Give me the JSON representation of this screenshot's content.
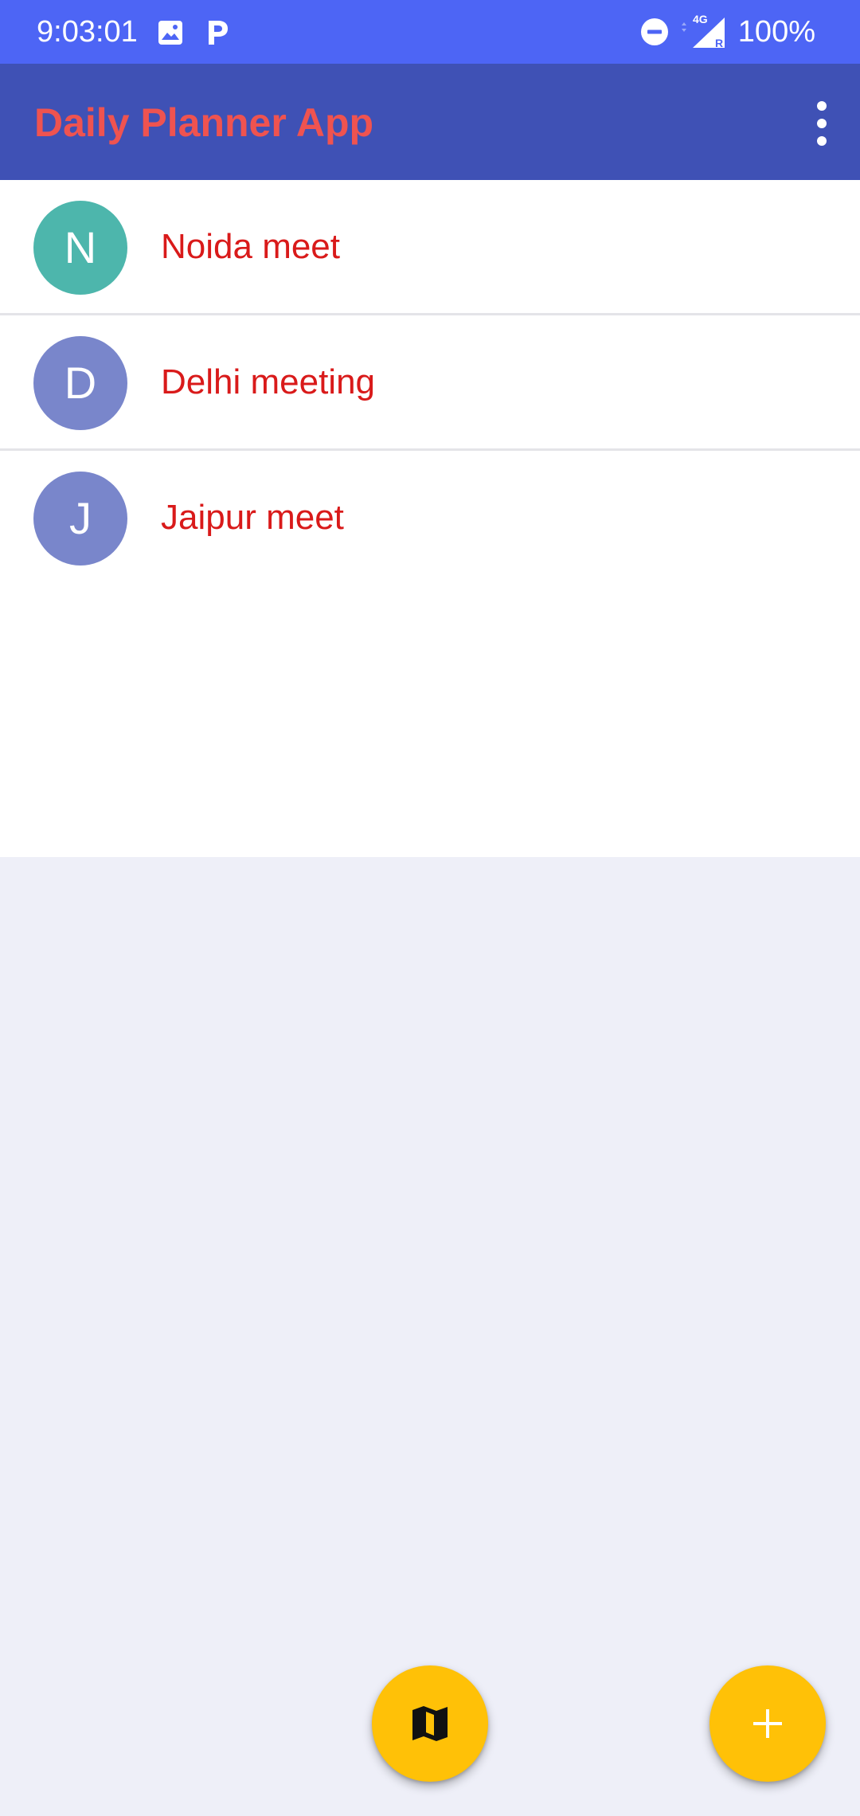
{
  "status_bar": {
    "time": "9:03:01",
    "battery": "100%",
    "network_label": "4G",
    "roaming_label": "R",
    "icons": [
      "image-icon",
      "paytm-icon",
      "dnd-icon",
      "signal-icon"
    ]
  },
  "app_bar": {
    "title": "Daily Planner App",
    "menu_icon": "more-vert-icon"
  },
  "plans": [
    {
      "initial": "N",
      "title": "Noida meet",
      "avatar_color": "#4db6ac"
    },
    {
      "initial": "D",
      "title": "Delhi meeting",
      "avatar_color": "#7986cb"
    },
    {
      "initial": "J",
      "title": "Jaipur meet",
      "avatar_color": "#7986cb"
    }
  ],
  "fabs": {
    "map_icon": "map-icon",
    "add_icon": "add-icon"
  },
  "colors": {
    "status_bar": "#4d65f5",
    "app_bar": "#3f51b5",
    "title_text": "#ef5350",
    "item_text": "#d91a1a",
    "fab": "#ffc107",
    "background": "#eeeff8"
  }
}
